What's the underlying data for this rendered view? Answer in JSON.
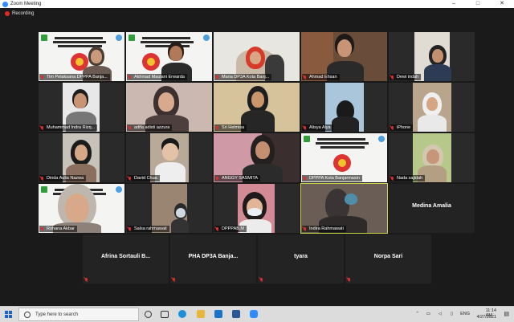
{
  "window": {
    "title": "Zoom Meeting",
    "minimize": "–",
    "maximize": "□",
    "close": "✕"
  },
  "recording": {
    "label": "Recording"
  },
  "participants": [
    {
      "name": "Tim Pelaksana DPPPA Banja...",
      "poster": true
    },
    {
      "name": "Akhmad Maulani Erwarda",
      "poster": true
    },
    {
      "name": "Maria DP3A Kota Banj..."
    },
    {
      "name": "Ahmad Ehsan"
    },
    {
      "name": "Dewi indah"
    },
    {
      "name": "Muhammad Indra Rizq..."
    },
    {
      "name": "adifa adisti azzura"
    },
    {
      "name": "Sri Helmisa"
    },
    {
      "name": "Alisya Alya"
    },
    {
      "name": "iPhone"
    },
    {
      "name": "Dinda Aulia Nazwa"
    },
    {
      "name": "David Chua"
    },
    {
      "name": "ANGGY SASMITA"
    },
    {
      "name": "DPPPA Kota Banjarmasin",
      "poster": true
    },
    {
      "name": "Nada sajidah"
    },
    {
      "name": "Rohana Akbar",
      "poster": true
    },
    {
      "name": "Salsa rahmawati"
    },
    {
      "name": "DPPPAB,M"
    },
    {
      "name": "Indira Rahmawati",
      "active": true
    },
    {
      "name": "Medina Amalia",
      "video_off": true
    },
    {
      "name": "Afrina Sortauli B...",
      "video_off": true
    },
    {
      "name": "PHA DP3A Banja...",
      "video_off": true
    },
    {
      "name": "tyara",
      "video_off": true
    },
    {
      "name": "Norpa Sari",
      "video_off": true
    }
  ],
  "taskbar": {
    "search_placeholder": "Type here to search",
    "icons": [
      "start-icon",
      "task-view-icon",
      "edge-icon",
      "file-explorer-icon",
      "mail-icon",
      "word-icon",
      "zoom-icon"
    ],
    "language": "ENG",
    "time": "11:14 AM",
    "date": "4/27/2021"
  },
  "colors": {
    "background": "#1a1a1a",
    "active_speaker": "#c9d64a",
    "muted": "#d73030",
    "taskbar": "#dcdcdc"
  }
}
